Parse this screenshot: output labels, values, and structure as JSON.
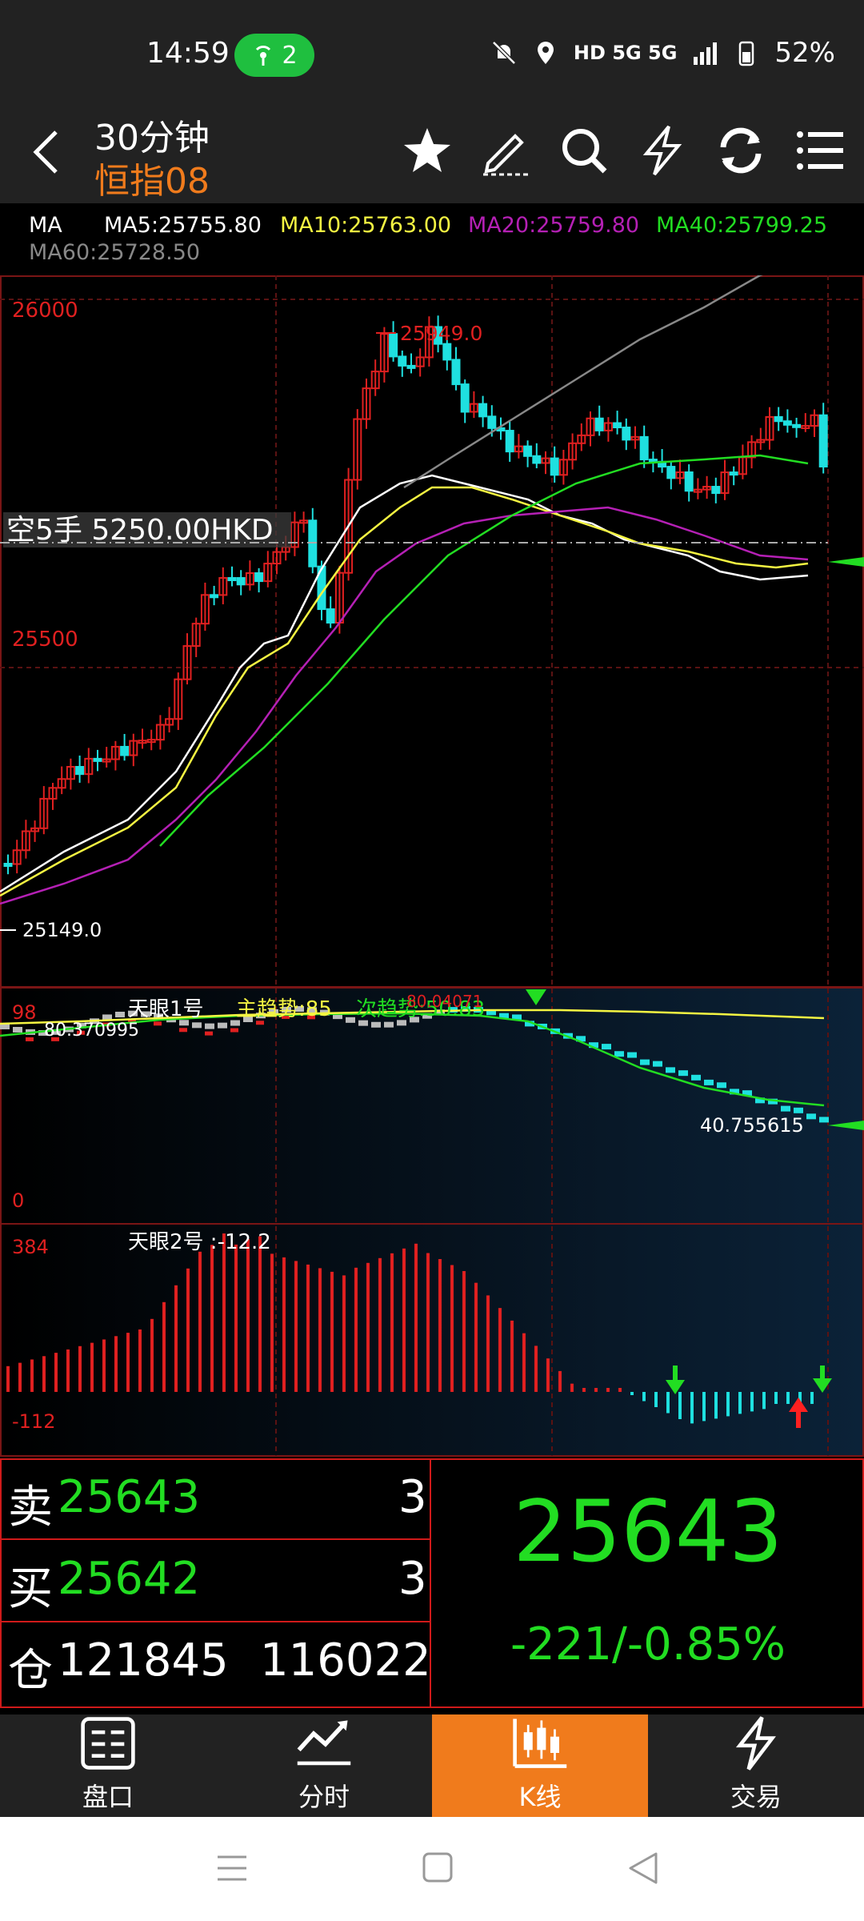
{
  "status": {
    "time": "14:59",
    "hotspot_count": "2",
    "network": "HD 5G 5G",
    "battery": "52%"
  },
  "header": {
    "title": "30分钟",
    "subtitle": "恒指08"
  },
  "ma_legend": {
    "label": "MA",
    "ma5": "MA5:25755.80",
    "ma10": "MA10:25763.00",
    "ma20": "MA20:25759.80",
    "ma40": "MA40:25799.25",
    "ma60": "MA60:25728.50"
  },
  "main_chart": {
    "y_top": "26000",
    "y_mid": "25500",
    "high_label": "25949.0",
    "low_label": "25149.0",
    "position_label": "空5手  5250.00HKD"
  },
  "indicator1": {
    "title": "天眼1号",
    "main_trend": "主趋势:85",
    "sub_trend": "次趋势:50.83",
    "extra": "80.04071",
    "y_top": "98",
    "y_bottom": "0",
    "left_value": "80.370995",
    "right_value": "40.755615"
  },
  "indicator2": {
    "title": "天眼2号 :-12.2",
    "y_top": "384",
    "y_bottom": "-112"
  },
  "orders": {
    "sell_label": "卖",
    "sell_price": "25643",
    "sell_qty": "3",
    "buy_label": "买",
    "buy_price": "25642",
    "buy_qty": "3",
    "pos_label": "仓",
    "pos_value1": "121845",
    "pos_value2": "116022",
    "last_price": "25643",
    "change": "-221/-0.85%"
  },
  "nav": {
    "item1": "盘口",
    "item2": "分时",
    "item3": "K线",
    "item4": "交易"
  },
  "colors": {
    "up": "#e02020",
    "down": "#1fe0e0",
    "accent": "#f07b1c",
    "green": "#22dd22",
    "yellow": "#f5f542",
    "magenta": "#b520b5"
  }
}
